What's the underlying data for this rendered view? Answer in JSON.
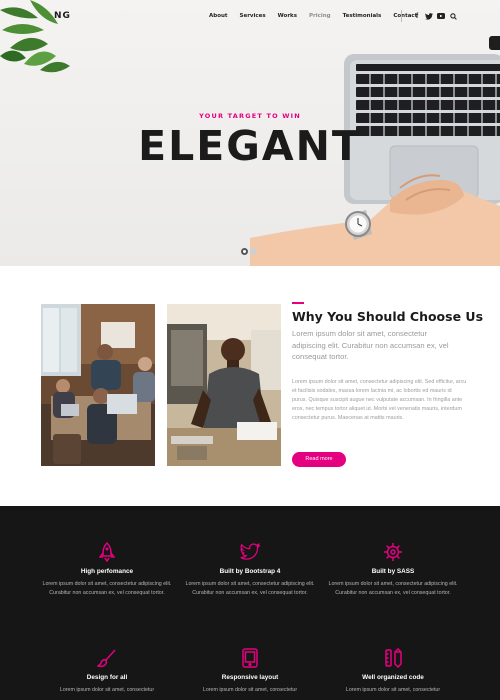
{
  "header": {
    "logo": "NG",
    "nav": [
      "About",
      "Services",
      "Works",
      "Pricing",
      "Testimonials",
      "Contact"
    ],
    "active_nav": "Pricing",
    "social_icons": [
      "facebook-icon",
      "twitter-icon",
      "youtube-icon",
      "search-icon"
    ]
  },
  "hero": {
    "subtitle": "YOUR TARGET TO WIN",
    "title": "ELEGANT",
    "slider_dots": 2,
    "active_dot": 1
  },
  "about": {
    "title": "Why You Should Choose Us",
    "lead": "Lorem ipsum dolor sit amet, consectetur adipiscing elit. Curabitur non accumsan ex, vel consequat tortor.",
    "body": "Lorem ipsum dolor sit amet, consectetur adipiscing elit. Sed efficitur, arcu et facilisis sodales, massa lorem lacinia mi, ac lobortis ed mauris id purus. Quisque suscipit augue nec vulputate accumsan. In fringilla ante eros, nec tempus tortor aliquet ut. Morbi vel venenatis mauris, interdum consectetur purus. Maecenas at mattis mauris.",
    "button": "Read more"
  },
  "features": [
    {
      "icon": "rocket-icon",
      "title": "High perfomance",
      "text": "Lorem ipsum dolor sit amet, consectetur adipiscing elit. Curabitur non accumsan ex, vel consequat tortor."
    },
    {
      "icon": "twitter-icon",
      "title": "Built by Bootstrap 4",
      "text": "Lorem ipsum dolor sit amet, consectetur adipiscing elit. Curabitur non accumsan ex, vel consequat tortor."
    },
    {
      "icon": "gear-icon",
      "title": "Built by SASS",
      "text": "Lorem ipsum dolor sit amet, consectetur adipiscing elit. Curabitur non accumsan ex, vel consequat tortor."
    },
    {
      "icon": "brush-icon",
      "title": "Design for all",
      "text": "Lorem ipsum dolor sit amet, consectetur"
    },
    {
      "icon": "tablet-icon",
      "title": "Responsive layout",
      "text": "Lorem ipsum dolor sit amet, consectetur"
    },
    {
      "icon": "pencil-ruler-icon",
      "title": "Well organized code",
      "text": "Lorem ipsum dolor sit amet, consectetur"
    }
  ],
  "colors": {
    "accent": "#e5007f",
    "dark_section": "#161616"
  }
}
